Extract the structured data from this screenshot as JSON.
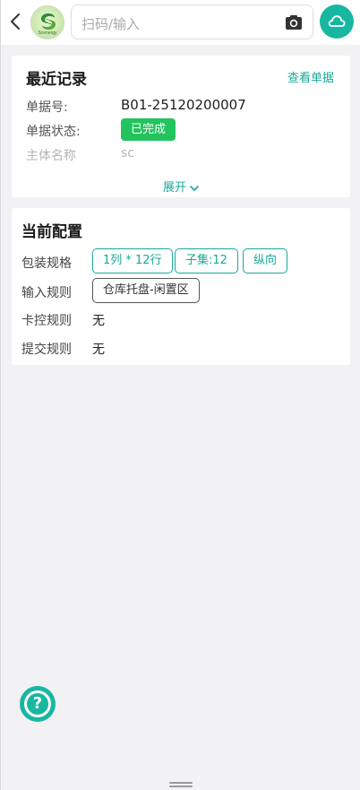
{
  "header": {
    "logo_text": "Scenergy",
    "search_placeholder": "扫码/输入"
  },
  "recent": {
    "title": "最近记录",
    "view_link": "查看单据",
    "doc_no_label": "单据号:",
    "doc_no_value": "B01-25120200007",
    "status_label": "单据状态:",
    "status_value": "已完成",
    "subject_label": "主体名称",
    "subject_value": "sc",
    "expand_label": "展开"
  },
  "config": {
    "title": "当前配置",
    "packaging_label": "包装规格",
    "packaging_tags": [
      "1列 * 12行",
      "子集:12",
      "纵向"
    ],
    "input_rule_label": "输入规则",
    "input_rule_tag": "仓库托盘-闲置区",
    "control_rule_label": "卡控规则",
    "control_rule_value": "无",
    "submit_rule_label": "提交规则",
    "submit_rule_value": "无"
  },
  "colors": {
    "accent": "#18b7a1",
    "status_green": "#23c45e"
  },
  "icons": [
    "back-arrow-icon",
    "logo",
    "camera-icon",
    "cloud-icon",
    "chevron-down-icon",
    "help-icon"
  ]
}
